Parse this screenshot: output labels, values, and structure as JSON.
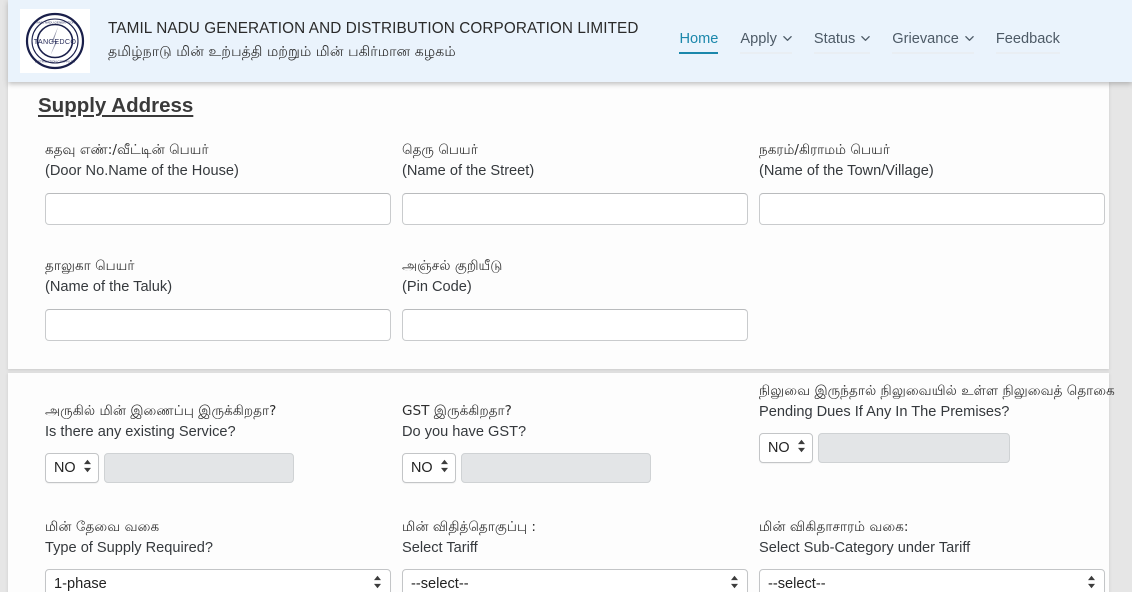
{
  "header": {
    "logo_alt": "TANGEDCO seal logo",
    "logo_text": "TANGEDCO",
    "org_name_en": "TAMIL NADU GENERATION AND DISTRIBUTION CORPORATION LIMITED",
    "org_name_ta": "தமிழ்நாடு மின் உற்பத்தி மற்றும் மின் பகிர்மான கழகம்",
    "accent_color": "#1b87ab",
    "background_color": "#eaf3fc",
    "nav": [
      {
        "label": "Home",
        "active": true,
        "has_caret": false
      },
      {
        "label": "Apply",
        "active": false,
        "has_caret": true
      },
      {
        "label": "Status",
        "active": false,
        "has_caret": true
      },
      {
        "label": "Grievance",
        "active": false,
        "has_caret": true
      },
      {
        "label": "Feedback",
        "active": false,
        "has_caret": false
      }
    ]
  },
  "supply_address": {
    "title": "Supply Address",
    "fields": [
      {
        "label_ta": "கதவு எண்:/வீட்டின் பெயர்",
        "label_en": "(Door No.Name of the House)",
        "value": "",
        "placeholder": ""
      },
      {
        "label_ta": "தெரு பெயர்",
        "label_en": "(Name of the Street)",
        "value": "",
        "placeholder": ""
      },
      {
        "label_ta": "நகரம்/கிராமம் பெயர்",
        "label_en": "(Name of the Town/Village)",
        "value": "",
        "placeholder": ""
      },
      {
        "label_ta": "தாலுகா பெயர்",
        "label_en": "(Name of the Taluk)",
        "value": "",
        "placeholder": ""
      },
      {
        "label_ta": "அஞ்சல் குறியீடு",
        "label_en": "(Pin Code)",
        "value": "",
        "placeholder": ""
      }
    ]
  },
  "service_details": {
    "existing_service": {
      "label_ta": "அருகில் மின் இணைப்பு இருக்கிறதா?",
      "label_en": "Is there any existing Service?",
      "select_value": "NO",
      "detail_value": "",
      "detail_disabled": true
    },
    "gst": {
      "label_ta": "GST இருக்கிறதா?",
      "label_en": "Do you have GST?",
      "select_value": "NO",
      "detail_value": "",
      "detail_disabled": true
    },
    "pending_dues": {
      "label_ta": "நிலுவை இருந்தால் நிலுவையில் உள்ள நிலுவைத் தொகை",
      "label_en": "Pending Dues If Any In The Premises?",
      "select_value": "NO",
      "detail_value": "",
      "detail_disabled": true
    },
    "supply_type": {
      "label_ta": "மின் தேவை வகை",
      "label_en": "Type of Supply Required?",
      "select_value": "1-phase"
    },
    "tariff": {
      "label_ta": "மின் விதித்தொகுப்பு :",
      "label_en": "Select Tariff",
      "select_value": "--select--"
    },
    "sub_category": {
      "label_ta": "மின் விகிதாசாரம் வகை:",
      "label_en": "Select Sub-Category under Tariff",
      "select_value": "--select--"
    }
  }
}
